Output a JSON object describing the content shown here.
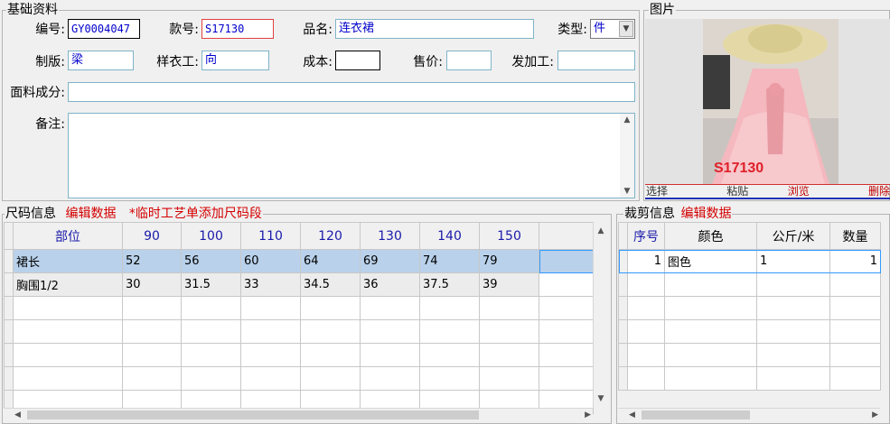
{
  "basic": {
    "legend": "基础资料",
    "code_label": "编号:",
    "code_value": "GY0004047",
    "style_label": "款号:",
    "style_value": "S17130",
    "name_label": "品名:",
    "name_value": "连衣裙",
    "type_label": "类型:",
    "type_value": "件",
    "pattern_label": "制版:",
    "pattern_value": "梁",
    "sample_label": "样衣工:",
    "sample_value": "向",
    "cost_label": "成本:",
    "cost_value": "",
    "price_label": "售价:",
    "price_value": "",
    "outsource_label": "发加工:",
    "outsource_value": "",
    "fabric_label": "面料成分:",
    "fabric_value": "",
    "remark_label": "备注:",
    "remark_value": ""
  },
  "photo": {
    "legend": "图片",
    "image_text": "S17130",
    "buttons": [
      "选择",
      "粘贴",
      "浏览",
      "删除"
    ]
  },
  "size": {
    "legend": "尺码信息",
    "edit_link": "编辑数据",
    "note": "*临时工艺单添加尺码段",
    "columns": [
      "部位",
      "90",
      "100",
      "110",
      "120",
      "130",
      "140",
      "150"
    ],
    "rows": [
      [
        "裙长",
        "52",
        "56",
        "60",
        "64",
        "69",
        "74",
        "79"
      ],
      [
        "胸围1/2",
        "30",
        "31.5",
        "33",
        "34.5",
        "36",
        "37.5",
        "39"
      ]
    ]
  },
  "cut": {
    "legend": "裁剪信息",
    "edit_link": "编辑数据",
    "columns": [
      "序号",
      "颜色",
      "公斤/米",
      "数量"
    ],
    "rows": [
      [
        "1",
        "图色",
        "1",
        "1"
      ]
    ]
  },
  "colors": {
    "accent_red": "#d40000",
    "header_blue": "#1a1aaa",
    "selected_row": "#b9d1ea"
  }
}
